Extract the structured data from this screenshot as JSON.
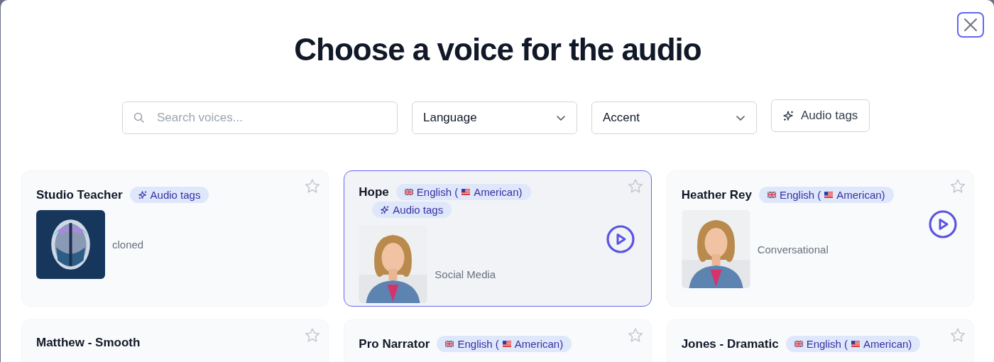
{
  "dialog": {
    "title": "Choose a voice for the audio"
  },
  "filters": {
    "search": {
      "placeholder": "Search voices..."
    },
    "dropdowns": [
      {
        "label": "Language"
      },
      {
        "label": "Accent"
      }
    ],
    "button": {
      "label": "Audio tags"
    }
  },
  "voices": [
    {
      "name": "Studio Teacher",
      "badges": [
        {
          "kind": "tags",
          "label": "Audio tags"
        }
      ],
      "description": "cloned",
      "avatar": {
        "kind": "picture"
      },
      "selected": false,
      "favorite": false,
      "playable": false
    },
    {
      "name": "Hope",
      "badges": [
        {
          "kind": "language",
          "language": "English (",
          "accent": "American)"
        },
        {
          "kind": "tags",
          "label": "Audio tags"
        }
      ],
      "description": "Social Media",
      "avatar": {
        "kind": "picture"
      },
      "selected": true,
      "favorite": false,
      "playable": true
    },
    {
      "name": "Heather Rey",
      "badges": [
        {
          "kind": "language",
          "language": "English (",
          "accent": "American)"
        }
      ],
      "description": "Conversational",
      "avatar": {
        "kind": "picture"
      },
      "selected": false,
      "favorite": false,
      "playable": true
    },
    {
      "name": "Matthew - Smooth",
      "selected": false,
      "favorite": false
    },
    {
      "name": "Pro Narrator",
      "badges": [
        {
          "kind": "language",
          "language": "English (",
          "accent": "American)"
        }
      ],
      "selected": false,
      "favorite": false
    },
    {
      "name": "Jones - Dramatic",
      "badges": [
        {
          "kind": "language",
          "language": "English (",
          "accent": "American)"
        }
      ],
      "selected": false,
      "favorite": false
    }
  ]
}
